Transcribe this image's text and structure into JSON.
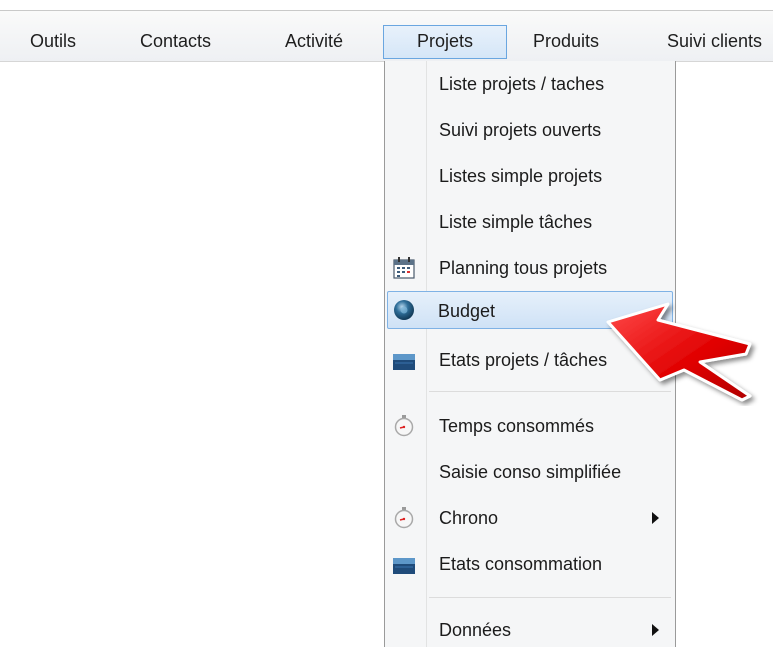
{
  "menubar": {
    "items": [
      {
        "label": "Outils"
      },
      {
        "label": "Contacts"
      },
      {
        "label": "Activité"
      },
      {
        "label": "Projets",
        "active": true
      },
      {
        "label": "Produits"
      },
      {
        "label": "Suivi clients"
      }
    ]
  },
  "dropdown": {
    "items": [
      {
        "label": "Liste projets / taches"
      },
      {
        "label": "Suivi projets ouverts"
      },
      {
        "label": "Listes simple projets"
      },
      {
        "label": "Liste simple tâches"
      },
      {
        "label": "Planning tous projets",
        "icon": "calendar-icon"
      },
      {
        "label": "Budget",
        "icon": "budget-globe-icon",
        "highlighted": true
      },
      {
        "label": "Etats projets / tâches",
        "icon": "printer-icon"
      },
      {
        "label": "Temps consommés",
        "icon": "stopwatch-icon"
      },
      {
        "label": "Saisie conso simplifiée"
      },
      {
        "label": "Chrono",
        "icon": "stopwatch-icon",
        "has_submenu": true
      },
      {
        "label": "Etats consommation",
        "icon": "printer-icon"
      },
      {
        "label": "Données",
        "has_submenu": true
      }
    ]
  },
  "colors": {
    "highlight_border": "#7fb2e5",
    "pointer_arrow": "#e60000"
  }
}
